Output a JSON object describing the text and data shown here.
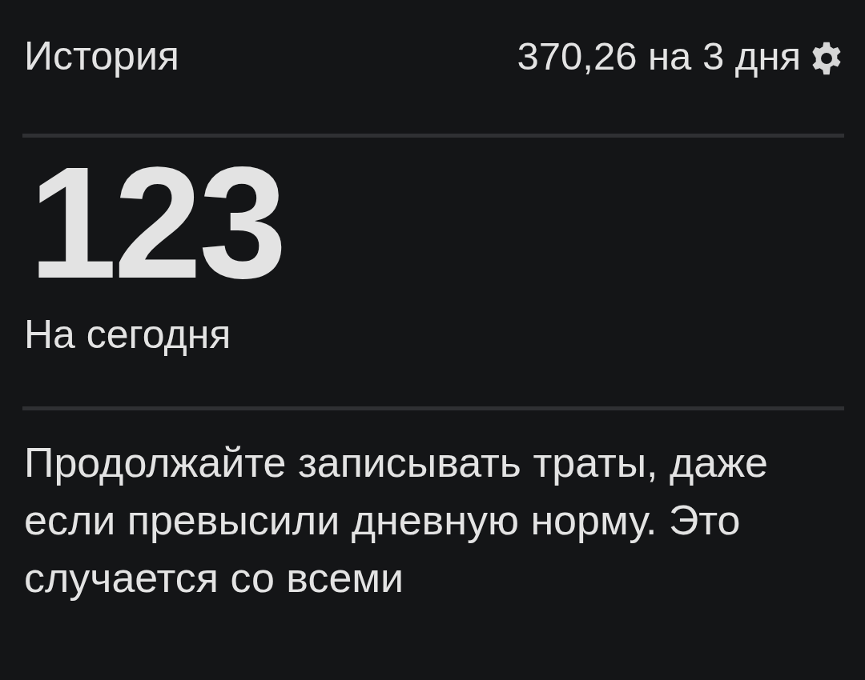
{
  "header": {
    "title": "История",
    "summary": "370,26 на 3 дня"
  },
  "today": {
    "amount": "123",
    "label": "На сегодня"
  },
  "message": "Продолжайте записывать траты, даже если превысили дневную норму. Это случается со всеми"
}
